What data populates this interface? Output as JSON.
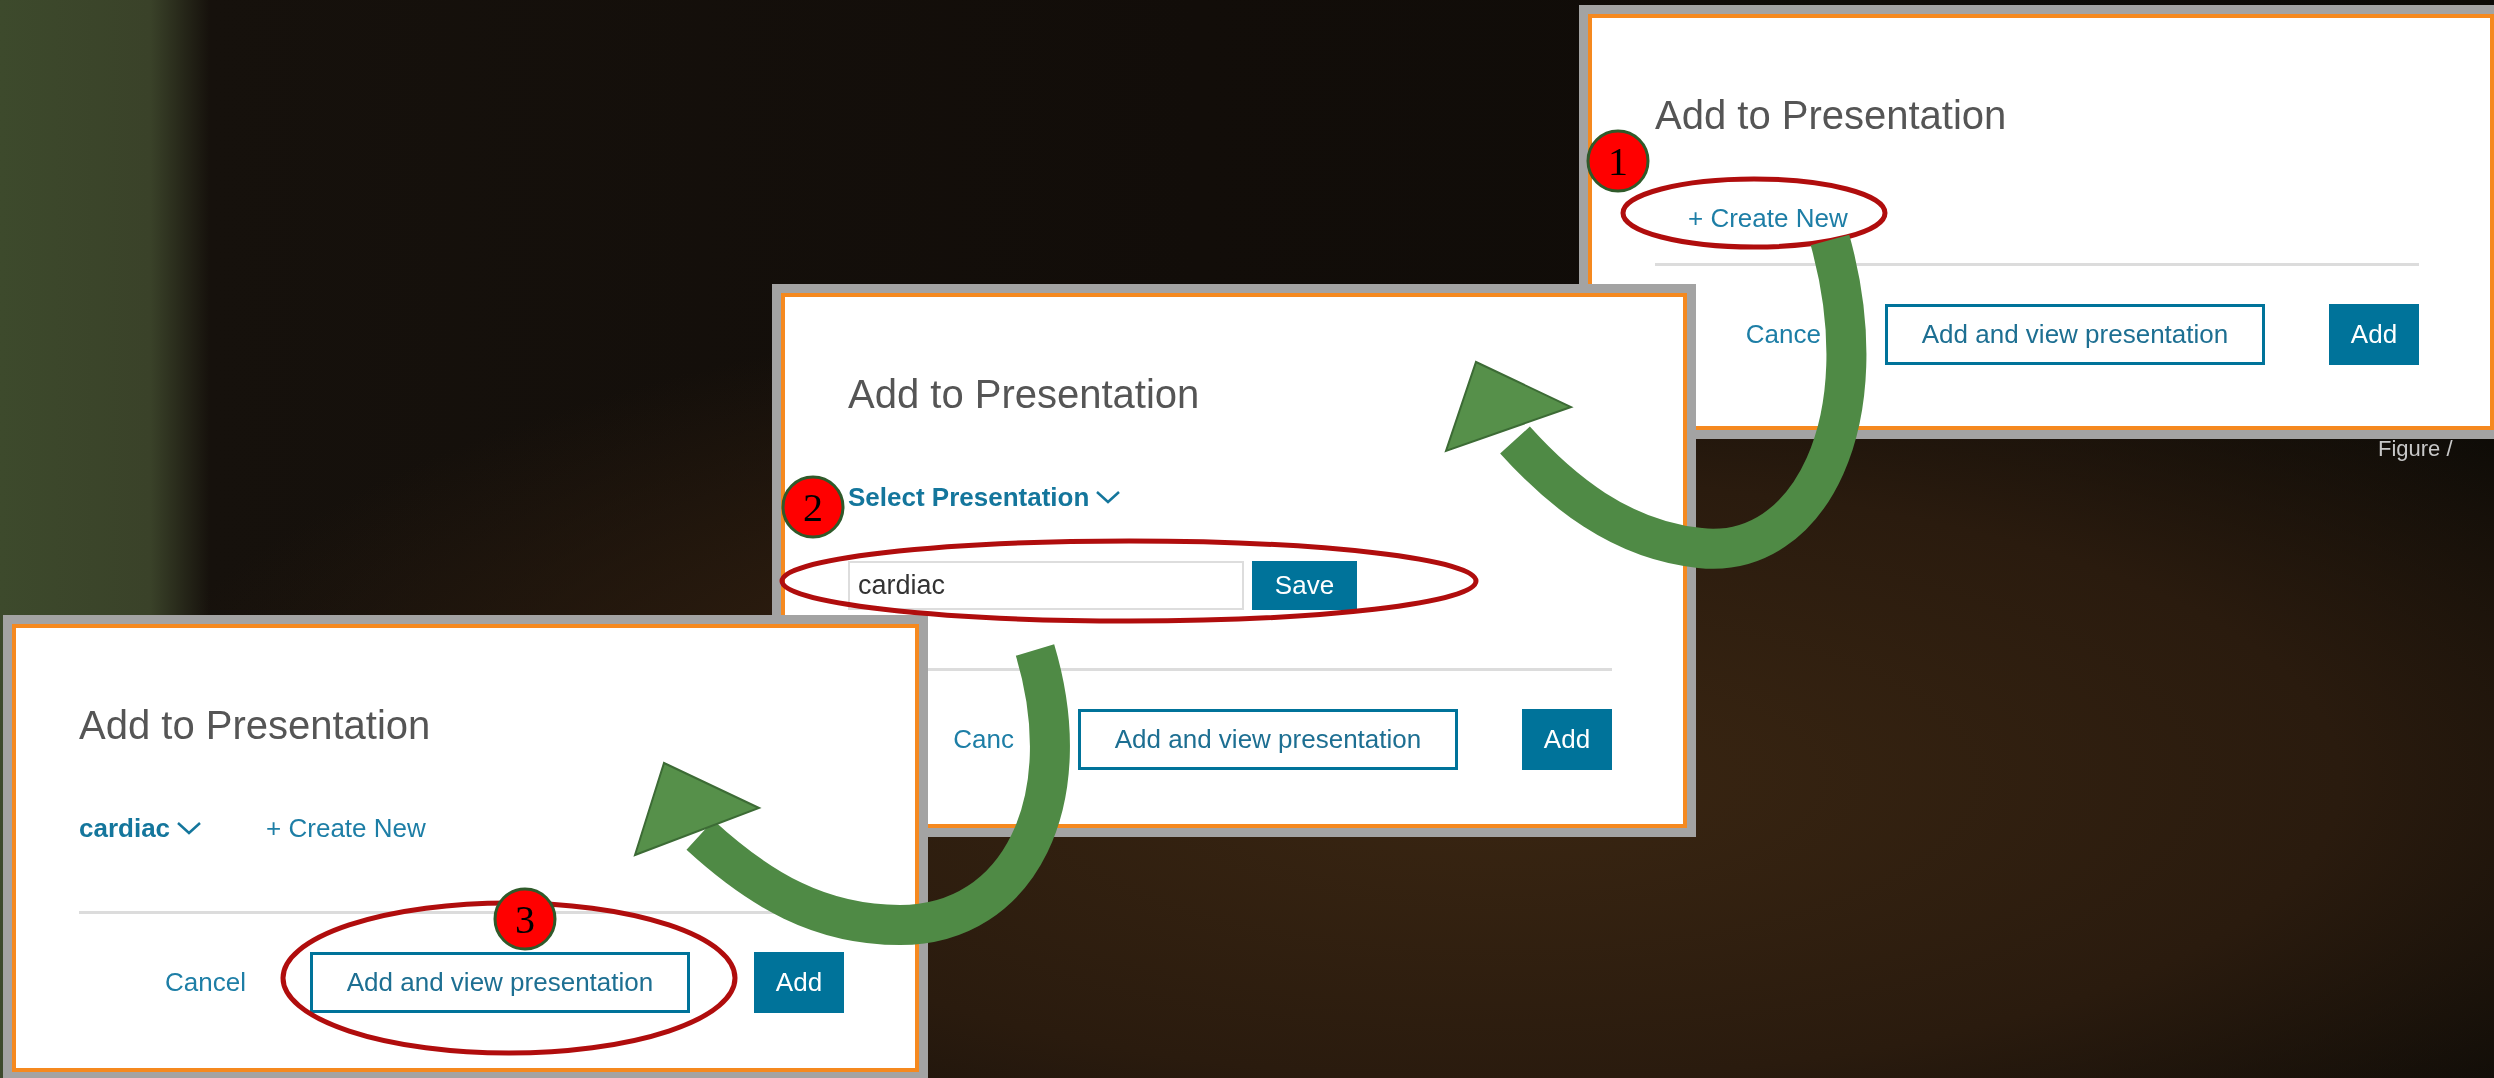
{
  "dialogs": [
    {
      "title": "Add to Presentation",
      "controls": [
        {
          "kind": "link",
          "label": "+ Create New"
        }
      ],
      "footer": {
        "cancel": "Cance",
        "secondary": "Add and view presentation",
        "primary": "Add"
      }
    },
    {
      "title": "Add to Presentation",
      "controls": [
        {
          "kind": "dropdown",
          "label": "Select Presentation"
        }
      ],
      "new_name": {
        "value": "cardiac",
        "button": "Save"
      },
      "footer": {
        "cancel": "Canc",
        "secondary": "Add and view presentation",
        "primary": "Add"
      }
    },
    {
      "title": "Add to Presentation",
      "controls": [
        {
          "kind": "dropdown",
          "label": "cardiac"
        },
        {
          "kind": "link",
          "label": "+ Create New"
        }
      ],
      "footer": {
        "cancel": "Cancel",
        "secondary": "Add and view presentation",
        "primary": "Add"
      }
    }
  ],
  "figure_caption": "Figure /",
  "steps": [
    {
      "number": "1"
    },
    {
      "number": "2"
    },
    {
      "number": "3"
    }
  ]
}
